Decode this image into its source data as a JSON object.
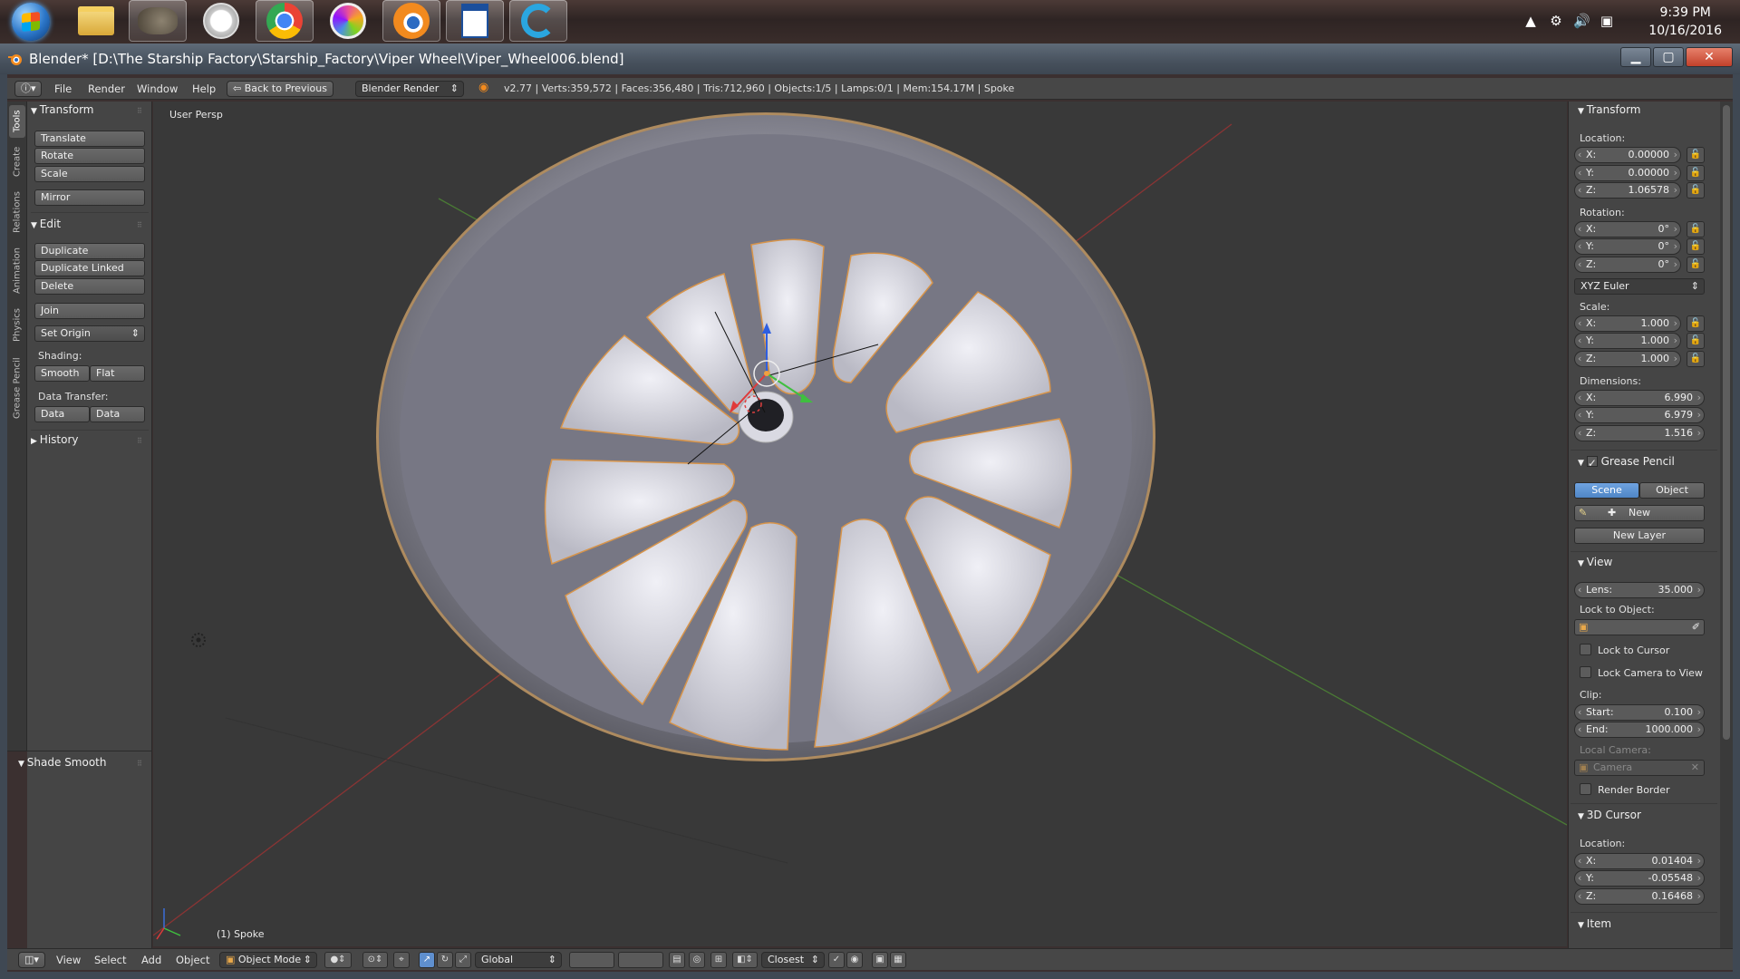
{
  "taskbar": {
    "apps": [
      "explorer-icon",
      "gimp-icon",
      "clock-app-icon",
      "chrome-icon",
      "krita-icon",
      "blender-icon",
      "writer-icon",
      "logitech-icon"
    ],
    "clock_time": "9:39 PM",
    "clock_date": "10/16/2016"
  },
  "window": {
    "title": "Blender* [D:\\The Starship Factory\\Starship_Factory\\Viper Wheel\\Viper_Wheel006.blend]"
  },
  "info": {
    "menus": [
      "File",
      "Render",
      "Window",
      "Help"
    ],
    "back_button": "Back to Previous",
    "engine": "Blender Render",
    "stats": "v2.77 | Verts:359,572 | Faces:356,480 | Tris:712,960 | Objects:1/5 | Lamps:0/1 | Mem:154.17M | Spoke"
  },
  "tabs": [
    "Tools",
    "Create",
    "Relations",
    "Animation",
    "Physics",
    "Grease Pencil"
  ],
  "toolshelf": {
    "transform_header": "Transform",
    "translate": "Translate",
    "rotate": "Rotate",
    "scale": "Scale",
    "mirror": "Mirror",
    "edit_header": "Edit",
    "duplicate": "Duplicate",
    "duplicate_linked": "Duplicate Linked",
    "delete": "Delete",
    "join": "Join",
    "set_origin": "Set Origin",
    "shading_label": "Shading:",
    "smooth": "Smooth",
    "flat": "Flat",
    "data_transfer_label": "Data Transfer:",
    "data": "Data",
    "data_layout": "Data Layo",
    "history_header": "History",
    "last_op_header": "Shade Smooth"
  },
  "viewport": {
    "persp_label": "User Persp",
    "object_label": "(1) Spoke"
  },
  "npanel": {
    "transform_header": "Transform",
    "location_label": "Location:",
    "location": {
      "x": "0.00000",
      "y": "0.00000",
      "z": "1.06578"
    },
    "rotation_label": "Rotation:",
    "rotation": {
      "x": "0°",
      "y": "0°",
      "z": "0°"
    },
    "rotation_mode": "XYZ Euler",
    "scale_label": "Scale:",
    "scale": {
      "x": "1.000",
      "y": "1.000",
      "z": "1.000"
    },
    "dimensions_label": "Dimensions:",
    "dimensions": {
      "x": "6.990",
      "y": "6.979",
      "z": "1.516"
    },
    "grease_header": "Grease Pencil",
    "scene_btn": "Scene",
    "object_btn": "Object",
    "new_btn": "New",
    "new_layer_btn": "New Layer",
    "view_header": "View",
    "lens_label": "Lens:",
    "lens_value": "35.000",
    "lock_to_object_label": "Lock to Object:",
    "lock_to_cursor": "Lock to Cursor",
    "lock_camera_to_view": "Lock Camera to View",
    "clip_label": "Clip:",
    "clip_start_label": "Start:",
    "clip_start": "0.100",
    "clip_end_label": "End:",
    "clip_end": "1000.000",
    "local_camera_label": "Local Camera:",
    "camera_field": "Camera",
    "render_border": "Render Border",
    "cursor_header": "3D Cursor",
    "cursor_location_label": "Location:",
    "cursor": {
      "x": "0.01404",
      "y": "-0.05548",
      "z": "0.16468"
    },
    "item_header": "Item"
  },
  "bottom": {
    "menus": [
      "View",
      "Select",
      "Add",
      "Object"
    ],
    "mode": "Object Mode",
    "orientation": "Global",
    "snap": "Closest"
  },
  "colors": {
    "accent": "#5f8fce",
    "selection_outline": "#f0a040"
  }
}
